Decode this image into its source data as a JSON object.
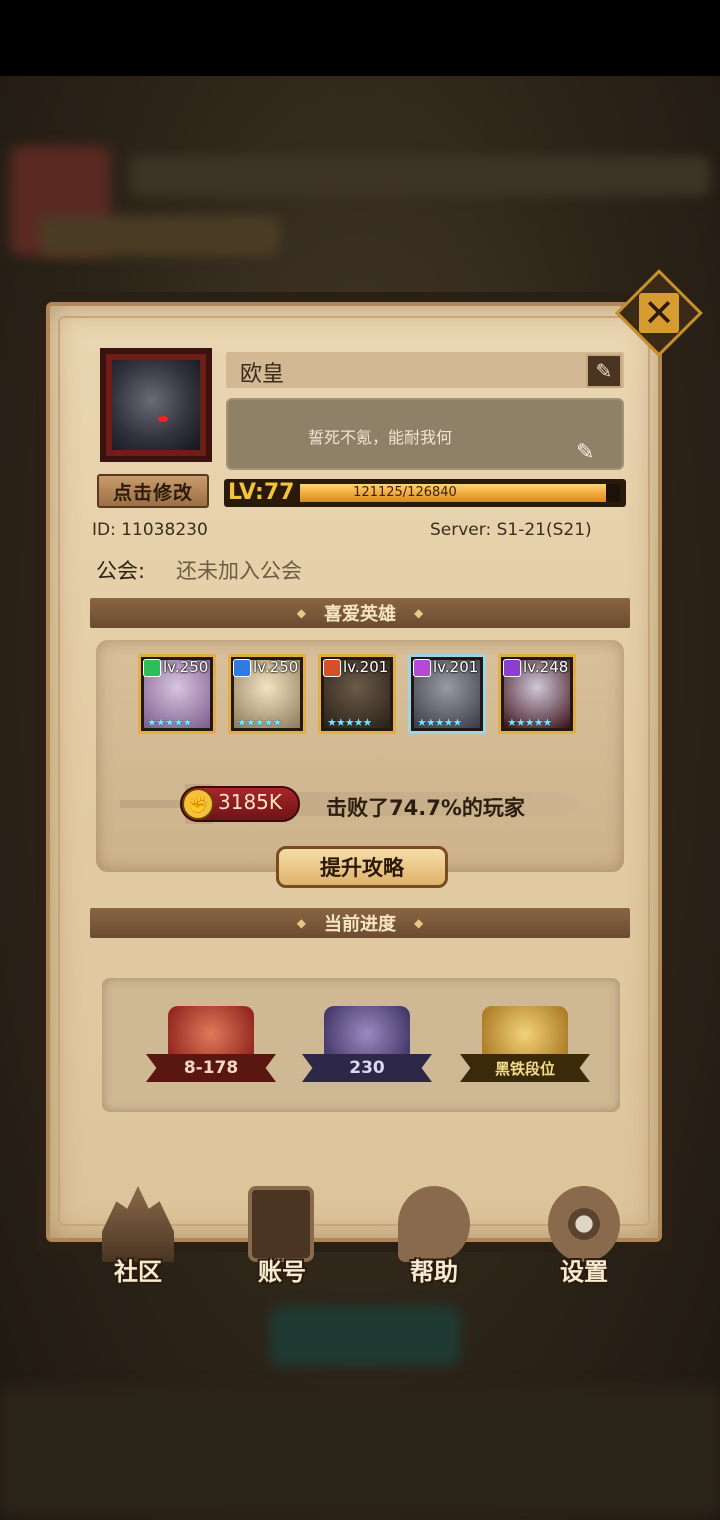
{
  "profile": {
    "name": "欧皇",
    "signature": "誓死不氪，能耐我何",
    "edit_portrait_label": "点击修改",
    "level_label": "LV:77",
    "exp_text": "121125/126840",
    "exp_progress": 0.955,
    "id_text": "ID:  11038230",
    "server_text": "Server:  S1-21(S21)",
    "guild_label": "公会:",
    "guild_value": "还未加入公会"
  },
  "favorite_heroes": {
    "title": "喜爱英雄",
    "heroes": [
      {
        "level": "lv.250",
        "element_color": "#2bbf5a",
        "frame_color": "#e4ad46"
      },
      {
        "level": "lv.250",
        "element_color": "#2f7be0",
        "frame_color": "#e4ad46"
      },
      {
        "level": "lv.201",
        "element_color": "#d2512a",
        "frame_color": "#e4ad46"
      },
      {
        "level": "lv.201",
        "element_color": "#b548d6",
        "frame_color": "#9fd4e6"
      },
      {
        "level": "lv.248",
        "element_color": "#8a3fd0",
        "frame_color": "#e4ad46"
      }
    ],
    "stars": "★★★★★"
  },
  "power": {
    "value": "3185K",
    "defeated_text": "击败了74.7%的玩家",
    "improve_label": "提升攻略"
  },
  "progress": {
    "title": "当前进度",
    "badges": [
      {
        "label": "8-178",
        "color": "#c23a2a"
      },
      {
        "label": "230",
        "color": "#6c5a9a"
      },
      {
        "label": "黑铁段位",
        "color": "#d9a93a"
      }
    ]
  },
  "nav": {
    "community": "社区",
    "account": "账号",
    "help": "帮助",
    "settings": "设置"
  }
}
